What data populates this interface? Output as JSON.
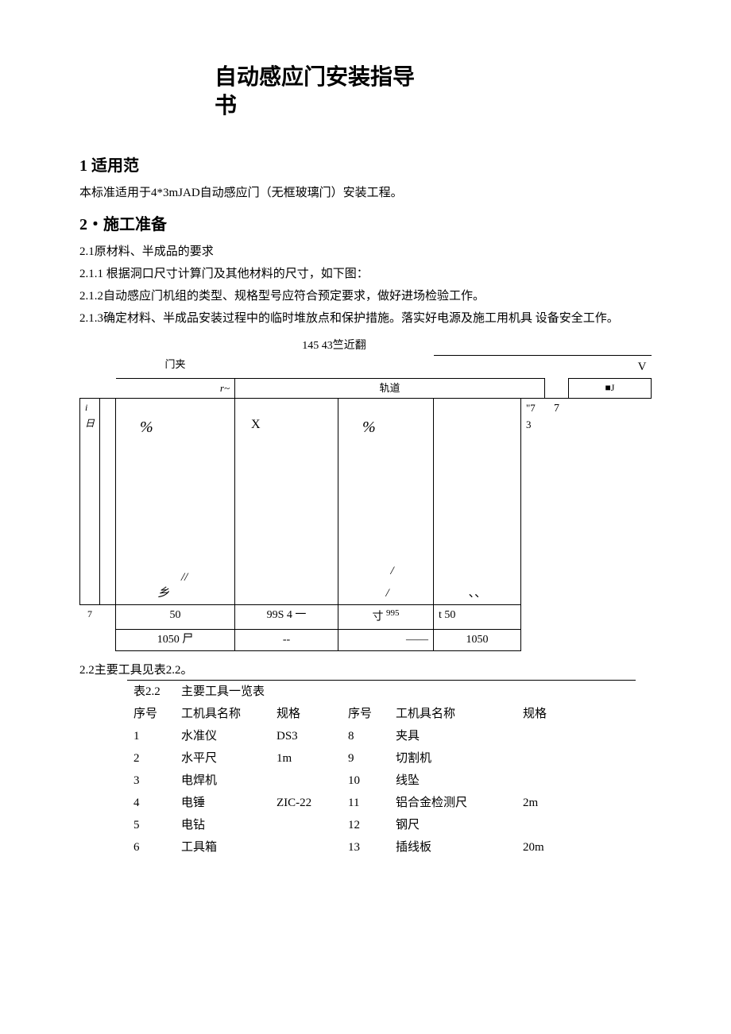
{
  "title": {
    "line1": "自动感应门安装指导",
    "line2": "书"
  },
  "section1": {
    "heading": "1  适用范",
    "body": "本标准适用于4*3mJAD自动感应门（无框玻璃门）安装工程。"
  },
  "section2": {
    "heading": "2・施工准备",
    "p1": "2.1原材料、半成品的要求",
    "p2": "2.1.1 根据洞口尺寸计算门及其他材料的尺寸，如下图：",
    "p3": "2.1.2自动感应门机组的类型、规格型号应符合预定要求，做好进场检验工作。",
    "p4": "2.1.3确定材料、半成品安装过程中的临时堆放点和保护措施。落实好电源及施工用机具 设备安全工作。"
  },
  "diagram": {
    "top_label": "145 43竺近翻",
    "clamp": "门夹",
    "track": "轨道",
    "r_sym": "r~",
    "v_sym": "V",
    "j_sym": "■J",
    "left_i": "i日",
    "seven3": "\"7 3",
    "seven": "7",
    "percent": "%",
    "x": "X",
    "slashes": "//",
    "xiang": "乡",
    "slash1": "/",
    "seven_left": "7",
    "dots": "、、",
    "row1_c1": "50",
    "row1_c2": "99S 4 一",
    "row1_c3": "寸",
    "row1_c3b": "995",
    "row1_c4": "t 50",
    "row2_c1": "1050 尸",
    "row2_c2": "--",
    "row2_c3": "——",
    "row2_c4": "1050"
  },
  "tools": {
    "intro": "2.2主要工具见表2.2。",
    "caption_left": "表2.2",
    "caption_right": "主要工具一览表",
    "headers": {
      "seq": "序号",
      "name": "工机具名称",
      "spec": "规格"
    },
    "rows": [
      {
        "seq": "1",
        "name": "水准仪",
        "spec": "DS3",
        "seq2": "8",
        "name2": "夹具",
        "spec2": ""
      },
      {
        "seq": "2",
        "name": "水平尺",
        "spec": "1m",
        "seq2": "9",
        "name2": "切割机",
        "spec2": ""
      },
      {
        "seq": "3",
        "name": "电焊机",
        "spec": "",
        "seq2": "10",
        "name2": "线坠",
        "spec2": ""
      },
      {
        "seq": "4",
        "name": "电锤",
        "spec": "ZIC-22",
        "seq2": "11",
        "name2": "铝合金检测尺",
        "spec2": "2m"
      },
      {
        "seq": "5",
        "name": "电钻",
        "spec": "",
        "seq2": "12",
        "name2": "钢尺",
        "spec2": ""
      },
      {
        "seq": "6",
        "name": "工具箱",
        "spec": "",
        "seq2": "13",
        "name2": "插线板",
        "spec2": "20m"
      }
    ]
  }
}
